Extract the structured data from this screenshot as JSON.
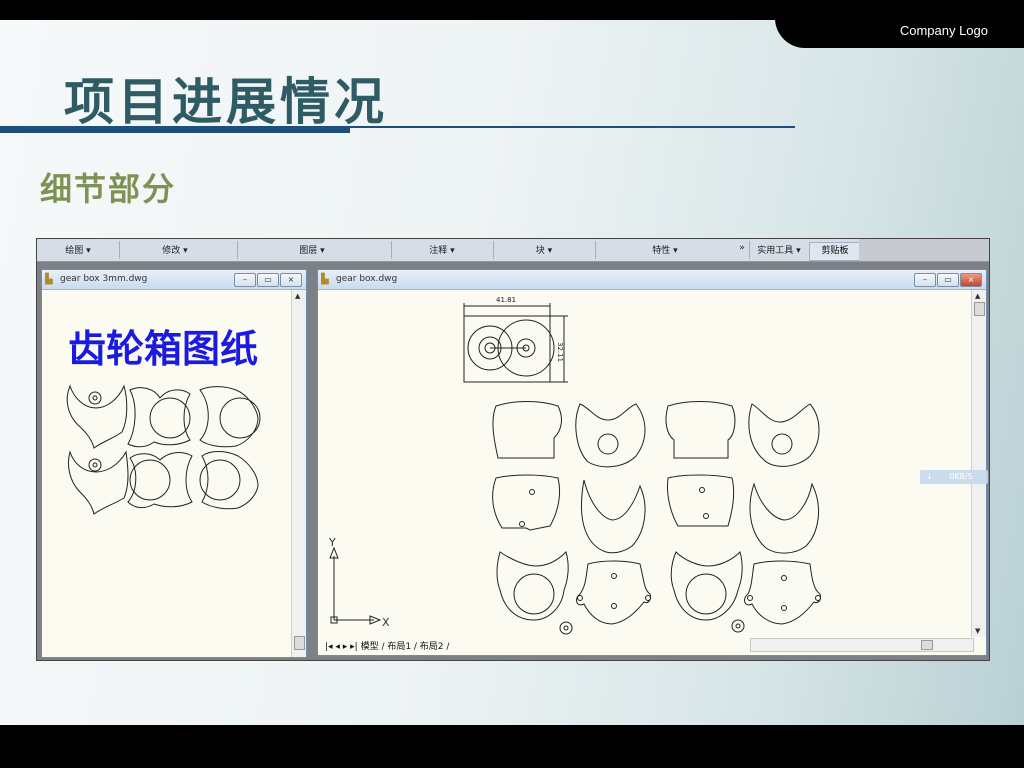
{
  "slide": {
    "logo_text": "Company Logo",
    "title": "项目进展情况",
    "subtitle": "细节部分"
  },
  "cad": {
    "ribbon": [
      "绘图 ▾",
      "修改 ▾",
      "图层 ▾",
      "注释 ▾",
      "块 ▾",
      "特性 ▾",
      "实用工具 ▾",
      "剪贴板"
    ],
    "ribbon_dialog_marker": "»",
    "left_window": {
      "title": "gear box 3mm.dwg",
      "label": "齿轮箱图纸"
    },
    "right_window": {
      "title": "gear box.dwg",
      "dim_width": "41.81",
      "dim_height": "32.11",
      "axis_y": "Y",
      "axis_x": "X",
      "tabs": "模型 / 布局1 / 布局2 /"
    },
    "download_badge": "0KB/S"
  },
  "colors": {
    "title": "#2f5b64",
    "subtitle": "#7f9254",
    "rule": "#1d4f7a",
    "drawing_label": "#1a1ae0"
  },
  "icons": {
    "window_icon": "dwg-file-icon",
    "minimize": "minimize-icon",
    "maximize": "maximize-icon",
    "close": "close-icon"
  }
}
